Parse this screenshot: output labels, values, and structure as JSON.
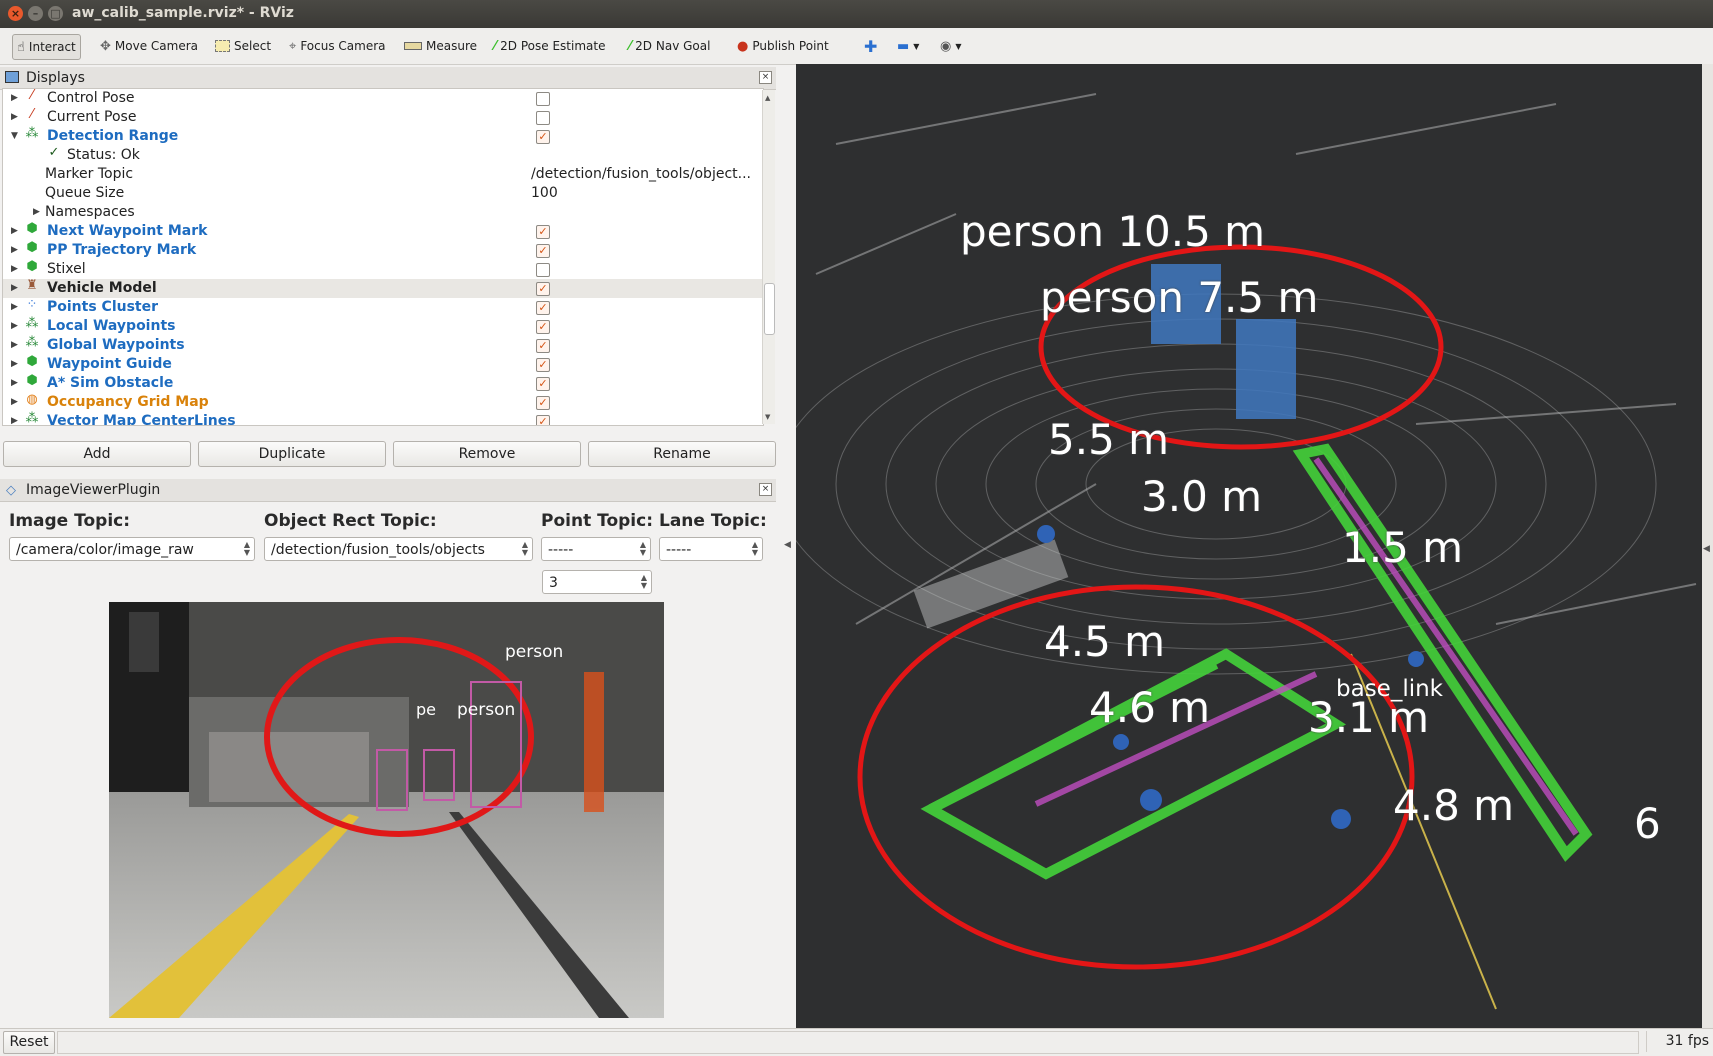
{
  "window": {
    "title": "aw_calib_sample.rviz* - RViz",
    "buttons": [
      "×",
      "–",
      "□"
    ]
  },
  "toolbar": {
    "tools": [
      {
        "label": "Interact",
        "icon": "hand-icon",
        "active": true
      },
      {
        "label": "Move Camera",
        "icon": "move-camera-icon"
      },
      {
        "label": "Select",
        "icon": "select-icon"
      },
      {
        "label": "Focus Camera",
        "icon": "focus-camera-icon"
      },
      {
        "label": "Measure",
        "icon": "ruler-icon"
      },
      {
        "label": "2D Pose Estimate",
        "icon": "pose-arrow-icon"
      },
      {
        "label": "2D Nav Goal",
        "icon": "nav-goal-arrow-icon"
      },
      {
        "label": "Publish Point",
        "icon": "map-pin-icon"
      }
    ],
    "extra_icons": [
      "plus-icon",
      "minus-icon",
      "eye-icon"
    ]
  },
  "displays": {
    "title": "Displays",
    "items": [
      {
        "label": "Control Pose",
        "style": "normal",
        "checked": false,
        "expanded": false,
        "icon": "pose-icon"
      },
      {
        "label": "Current Pose",
        "style": "normal",
        "checked": false,
        "expanded": false,
        "icon": "pose-icon"
      },
      {
        "label": "Detection Range",
        "style": "blue",
        "checked": true,
        "expanded": true,
        "icon": "marker-icon"
      },
      {
        "label": "Status: Ok",
        "style": "child-status"
      },
      {
        "label": "Marker Topic",
        "style": "child",
        "value": "/detection/fusion_tools/object..."
      },
      {
        "label": "Queue Size",
        "style": "child",
        "value": "100"
      },
      {
        "label": "Namespaces",
        "style": "child-expandable"
      },
      {
        "label": "Next Waypoint Mark",
        "style": "blue",
        "checked": true,
        "icon": "cube-icon"
      },
      {
        "label": "PP Trajectory Mark",
        "style": "blue",
        "checked": true,
        "icon": "cube-icon"
      },
      {
        "label": "Stixel",
        "style": "normal",
        "checked": false,
        "icon": "cube-icon"
      },
      {
        "label": "Vehicle Model",
        "style": "bold",
        "checked": true,
        "icon": "robot-icon",
        "selected": true
      },
      {
        "label": "Points Cluster",
        "style": "blue",
        "checked": true,
        "icon": "pointcloud-icon"
      },
      {
        "label": "Local Waypoints",
        "style": "blue",
        "checked": true,
        "icon": "marker-icon"
      },
      {
        "label": "Global Waypoints",
        "style": "blue",
        "checked": true,
        "icon": "marker-icon"
      },
      {
        "label": "Waypoint Guide",
        "style": "blue",
        "checked": true,
        "icon": "cube-icon"
      },
      {
        "label": "A* Sim Obstacle",
        "style": "blue",
        "checked": true,
        "icon": "cube-icon"
      },
      {
        "label": "Occupancy Grid Map",
        "style": "orange",
        "checked": true,
        "icon": "grid-map-icon"
      },
      {
        "label": "Vector Map CenterLines",
        "style": "blue",
        "checked": true,
        "icon": "marker-icon"
      }
    ],
    "buttons": {
      "add": "Add",
      "duplicate": "Duplicate",
      "remove": "Remove",
      "rename": "Rename"
    }
  },
  "image_viewer": {
    "title": "ImageViewerPlugin",
    "image_topic_label": "Image Topic:",
    "image_topic_value": "/camera/color/image_raw",
    "object_rect_label": "Object Rect Topic:",
    "object_rect_value": "/detection/fusion_tools/objects",
    "point_topic_label": "Point Topic:",
    "point_topic_value": "-----",
    "lane_topic_label": "Lane Topic:",
    "lane_topic_value": "-----",
    "point_size_value": "3",
    "detections": [
      "person",
      "pe",
      "person"
    ]
  },
  "view3d": {
    "labels": [
      {
        "text": "person  10.5  m"
      },
      {
        "text": "person  7.5  m"
      },
      {
        "text": "5.5  m"
      },
      {
        "text": "3.0  m"
      },
      {
        "text": "1.5  m"
      },
      {
        "text": "4.5  m"
      },
      {
        "text": "4.6  m"
      },
      {
        "text": "3.1  m"
      },
      {
        "text": "4.8  m"
      },
      {
        "text": "6"
      }
    ],
    "frame_label": "base_link"
  },
  "status": {
    "reset_label": "Reset",
    "fps": "31 fps"
  }
}
